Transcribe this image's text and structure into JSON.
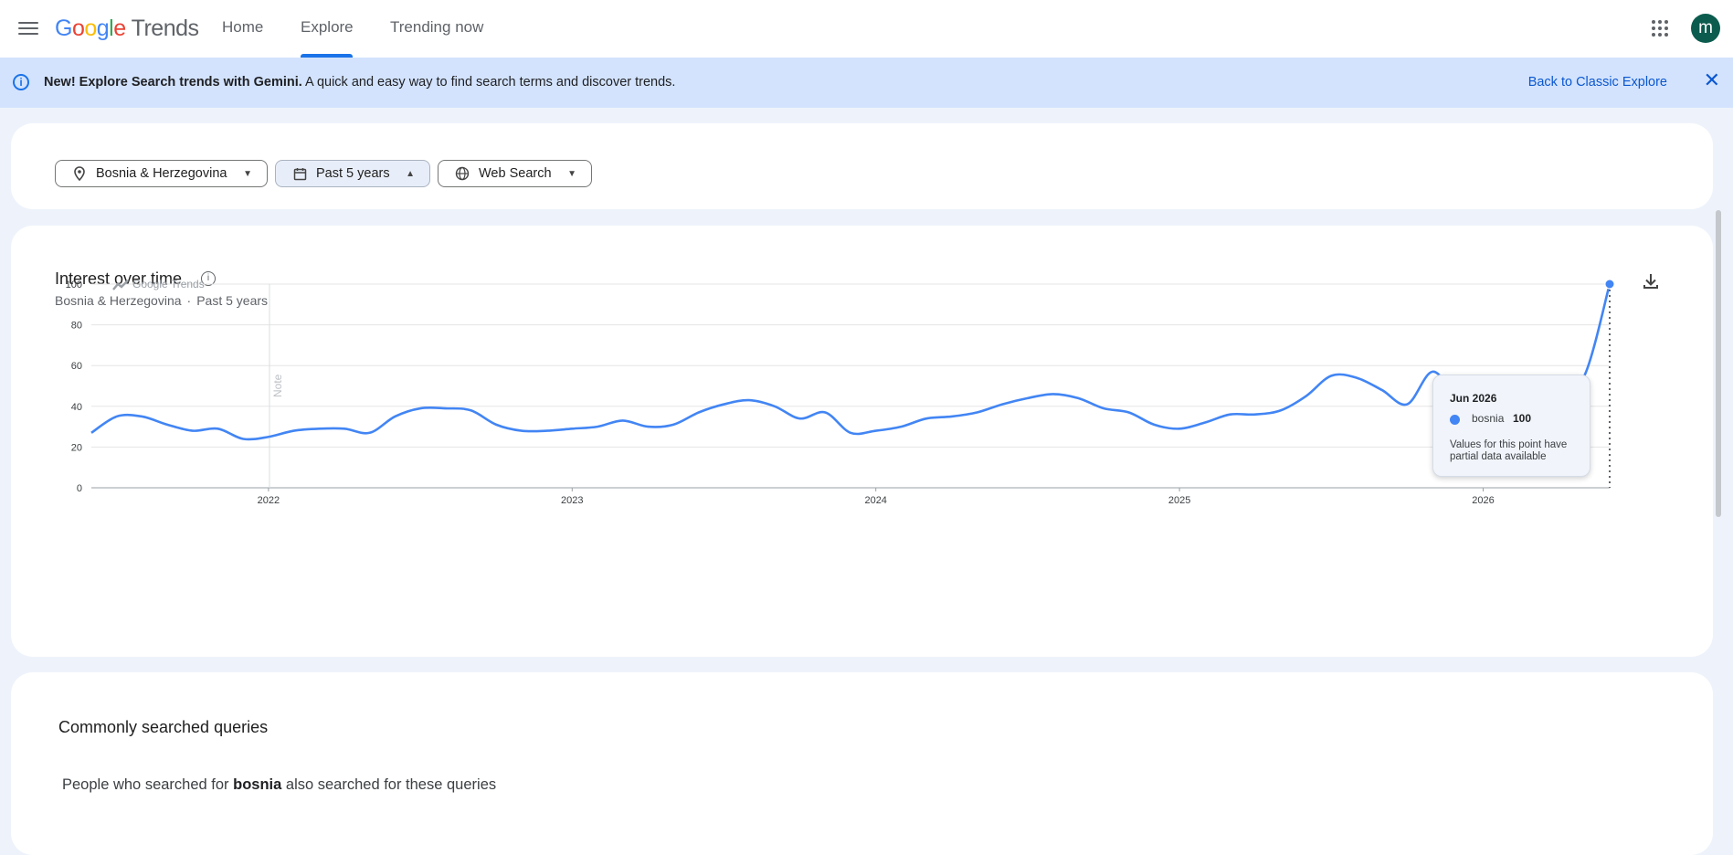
{
  "topbar": {
    "logo_google": [
      "G",
      "o",
      "o",
      "g",
      "l",
      "e"
    ],
    "logo_product": "Trends",
    "nav": [
      {
        "label": "Home",
        "active": false
      },
      {
        "label": "Explore",
        "active": true
      },
      {
        "label": "Trending now",
        "active": false
      }
    ],
    "avatar_letter": "m",
    "icons": [
      "menu-icon",
      "apps-grid-icon"
    ]
  },
  "banner": {
    "bold": "New! Explore Search trends with Gemini.",
    "text": " A quick and easy way to find search terms and discover trends.",
    "link": "Back to Classic Explore",
    "close": "✕"
  },
  "filters": {
    "location": "Bosnia & Herzegovina",
    "time": "Past 5 years",
    "property": "Web Search"
  },
  "chart": {
    "title": "Interest over time",
    "subtitle_location": "Bosnia & Herzegovina",
    "subtitle_separator": "·",
    "subtitle_time": "Past 5 years",
    "watermark": "Google Trends",
    "note_label": "Note",
    "tooltip": {
      "date": "Jun 2026",
      "term": "bosnia",
      "value": "100",
      "note": "Values for this point have partial data available"
    },
    "colors": {
      "line": "#4285f4",
      "grid": "#e5e5e5"
    }
  },
  "chart_data": {
    "type": "line",
    "title": "Interest over time",
    "x_ticks": [
      "2022",
      "2023",
      "2024",
      "2025",
      "2026"
    ],
    "y_ticks": [
      0,
      20,
      40,
      60,
      80,
      100
    ],
    "ylim": [
      0,
      100
    ],
    "x_start": "2021-06",
    "x_end": "2026-06",
    "grid": true,
    "series": [
      {
        "name": "bosnia",
        "x": [
          "2021-06",
          "2021-07",
          "2021-08",
          "2021-09",
          "2021-10",
          "2021-11",
          "2021-12",
          "2022-01",
          "2022-02",
          "2022-03",
          "2022-04",
          "2022-05",
          "2022-06",
          "2022-07",
          "2022-08",
          "2022-09",
          "2022-10",
          "2022-11",
          "2022-12",
          "2023-01",
          "2023-02",
          "2023-03",
          "2023-04",
          "2023-05",
          "2023-06",
          "2023-07",
          "2023-08",
          "2023-09",
          "2023-10",
          "2023-11",
          "2023-12",
          "2024-01",
          "2024-02",
          "2024-03",
          "2024-04",
          "2024-05",
          "2024-06",
          "2024-07",
          "2024-08",
          "2024-09",
          "2024-10",
          "2024-11",
          "2024-12",
          "2025-01",
          "2025-02",
          "2025-03",
          "2025-04",
          "2025-05",
          "2025-06",
          "2025-07",
          "2025-08",
          "2025-09",
          "2025-10",
          "2025-11",
          "2025-12",
          "2026-01",
          "2026-02",
          "2026-03",
          "2026-04",
          "2026-05",
          "2026-06"
        ],
        "values": [
          27,
          35,
          35,
          31,
          28,
          29,
          24,
          25,
          28,
          29,
          29,
          27,
          35,
          39,
          39,
          38,
          31,
          28,
          28,
          29,
          30,
          33,
          30,
          31,
          37,
          41,
          43,
          40,
          34,
          37,
          27,
          28,
          30,
          34,
          35,
          37,
          41,
          44,
          46,
          44,
          39,
          37,
          31,
          29,
          32,
          36,
          36,
          38,
          45,
          55,
          54,
          48,
          41,
          57,
          44,
          41,
          50,
          52,
          49,
          55,
          100
        ]
      }
    ]
  },
  "queries": {
    "title": "Commonly searched queries",
    "sub_prefix": "People who searched for ",
    "sub_term": "bosnia",
    "sub_suffix": " also searched for these queries"
  }
}
